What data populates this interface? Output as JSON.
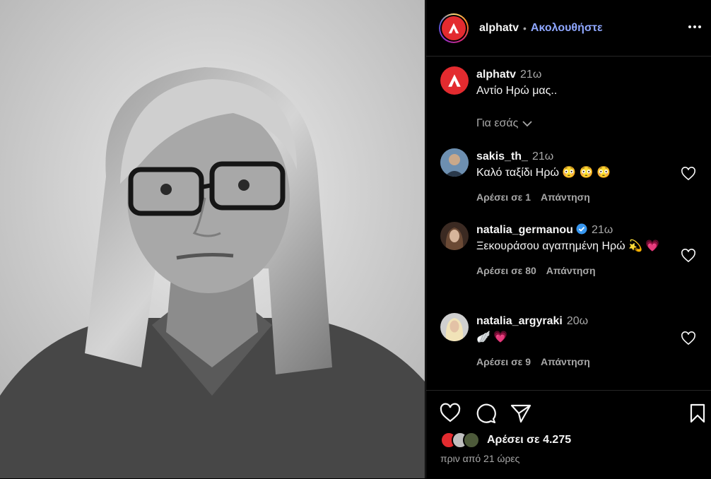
{
  "post": {
    "account": "alphatv",
    "separator": "•",
    "follow_label": "Ακολουθήστε",
    "caption_user": "alphatv",
    "caption_time": "21ω",
    "caption_text": "Αντίο Ηρώ μας..",
    "for_you_label": "Για εσάς",
    "likes_label": "Αρέσει σε 4.275",
    "posted_ago": "πριν από 21 ώρες"
  },
  "comments": [
    {
      "user": "sakis_th_",
      "time": "21ω",
      "text": "Καλό ταξίδι Ηρώ 😳 😳 😳",
      "likes": "Αρέσει σε 1",
      "reply": "Απάντηση",
      "verified": false
    },
    {
      "user": "natalia_germanou",
      "time": "21ω",
      "text": "Ξεκουράσου αγαπημένη Ηρώ 💫 💗",
      "likes": "Αρέσει σε 80",
      "reply": "Απάντηση",
      "verified": true
    },
    {
      "user": "natalia_argyraki",
      "time": "20ω",
      "text": "🪽 💗",
      "likes": "Αρέσει σε 9",
      "reply": "Απάντηση",
      "verified": false
    }
  ],
  "colors": {
    "accent": "#8fa7ff",
    "brand_red": "#e32b2f",
    "muted": "#a8a8a8",
    "border": "#262626"
  },
  "icons": [
    "more-options-icon",
    "heart-icon",
    "comment-icon",
    "share-icon",
    "bookmark-icon",
    "chevron-down-icon",
    "verified-badge-icon"
  ]
}
